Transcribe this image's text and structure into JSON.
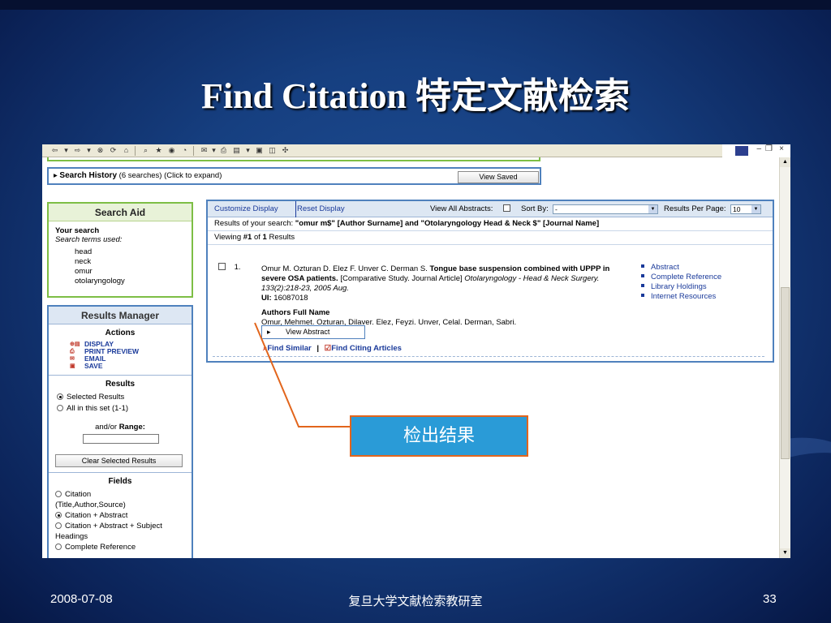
{
  "slide": {
    "title": "Find Citation  特定文献检索",
    "footer_date": "2008-07-08",
    "footer_center": "复旦大学文献检索教研室",
    "page_number": "33",
    "callout_text": "检出结果"
  },
  "browser": {
    "window_controls": [
      "–",
      "❐",
      "×"
    ]
  },
  "history": {
    "label": "Search History",
    "detail": "(6 searches) (Click to expand)",
    "view_saved": "View Saved"
  },
  "search_aid": {
    "title": "Search Aid",
    "your_search": "Your search",
    "terms_label": "Search terms used:",
    "terms": [
      "head",
      "neck",
      "omur",
      "otolaryngology"
    ]
  },
  "results_manager": {
    "title": "Results Manager",
    "actions_title": "Actions",
    "actions": [
      "DISPLAY",
      "PRINT PREVIEW",
      "EMAIL",
      "SAVE"
    ],
    "results_title": "Results",
    "result_options": [
      "Selected Results",
      "All in this set (1-1)"
    ],
    "range_label_prefix": "and/or ",
    "range_label_bold": "Range:",
    "clear_button": "Clear Selected Results",
    "fields_title": "Fields",
    "field_options": [
      "Citation",
      "(Title,Author,Source)",
      "Citation + Abstract",
      "Citation + Abstract + Subject",
      "Headings",
      "Complete Reference"
    ]
  },
  "results": {
    "customize_display": "Customize Display",
    "reset_display": "Reset Display",
    "view_all_abstracts": "View All Abstracts:",
    "sort_by_label": "Sort By:",
    "sort_by_value": "-",
    "per_page_label": "Results Per Page:",
    "per_page_value": "10",
    "search_prefix": "Results of your search: ",
    "search_query": "\"omur m$\" [Author Surname] and \"Otolaryngology Head & Neck $\" [Journal Name]",
    "viewing_prefix": "Viewing ",
    "viewing_num": "#1",
    "viewing_mid": " of ",
    "viewing_total": "1",
    "viewing_suffix": " Results",
    "record": {
      "number": "1.",
      "authors": "Omur M. Ozturan D. Elez F. Unver C. Derman S. ",
      "title": "Tongue base suspension combined with UPPP in severe OSA patients.",
      "pub_type": " [Comparative Study. Journal Article] ",
      "journal": "Otolaryngology - Head & Neck Surgery. 133(2):218-23, 2005 Aug.",
      "ui_label": "UI:",
      "ui_value": " 16087018",
      "authors_full_label": "Authors Full Name",
      "authors_full": "Omur, Mehmet. Ozturan, Dilaver. Elez, Feyzi. Unver, Celal. Derman, Sabri.",
      "view_abstract": "View Abstract",
      "find_similar": "Find Similar",
      "find_citing": "Find Citing Articles",
      "side_links": [
        "Abstract",
        "Complete Reference",
        "Library Holdings",
        "Internet Resources"
      ]
    }
  },
  "colors": {
    "green_border": "#7dbe45",
    "blue_border": "#4f81bd",
    "link_blue": "#1a3a9a",
    "callout_fill": "#2a9bd7",
    "callout_border": "#e2651c"
  }
}
